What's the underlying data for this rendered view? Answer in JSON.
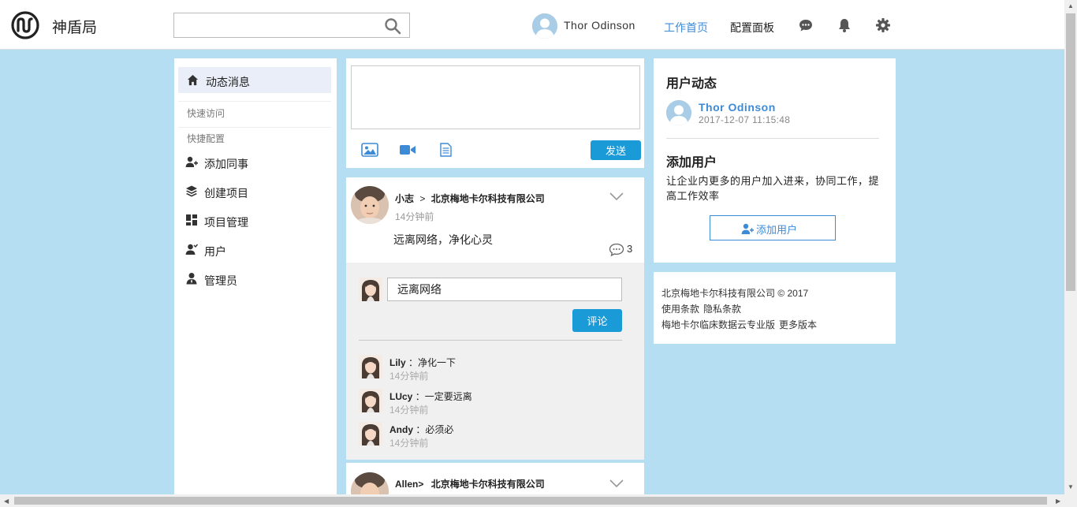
{
  "header": {
    "brand": "神盾局",
    "search_placeholder": "",
    "user_name": "Thor Odinson",
    "nav_home": "工作首页",
    "nav_panel": "配置面板",
    "accent_color": "#3d8ad6"
  },
  "sidebar": {
    "active_item": "动态消息",
    "section_quick_access": "快速访问",
    "section_quick_config": "快捷配置",
    "items": [
      {
        "label": "添加同事",
        "icon": "add-colleague-icon"
      },
      {
        "label": "创建项目",
        "icon": "layers-icon"
      },
      {
        "label": "项目管理",
        "icon": "dashboard-icon"
      },
      {
        "label": "用户",
        "icon": "user-icon"
      },
      {
        "label": "管理员",
        "icon": "admin-icon"
      }
    ]
  },
  "composer": {
    "send_label": "发送",
    "button_color": "#1a9ad6"
  },
  "post": {
    "author": "小志",
    "separator": ">",
    "company": "北京梅地卡尔科技有限公司",
    "time": "14分钟前",
    "content": "远离网络，净化心灵",
    "comment_count": "3",
    "comment_input_value": "远离网络",
    "comment_button": "评论",
    "comments": [
      {
        "name": "Lily",
        "sep": "：",
        "text": "净化一下",
        "time": "14分钟前"
      },
      {
        "name": "LUcy",
        "sep": "：",
        "text": "一定要远离",
        "time": "14分钟前"
      },
      {
        "name": "Andy",
        "sep": "：",
        "text": "必须必",
        "time": "14分钟前"
      }
    ]
  },
  "post2": {
    "author": "Allen>",
    "company": "北京梅地卡尔科技有限公司"
  },
  "activity": {
    "title": "用户动态",
    "user": "Thor Odinson",
    "time": "2017-12-07 11:15:48"
  },
  "add_user": {
    "title": "添加用户",
    "description": "让企业内更多的用户加入进来，协同工作，提高工作效率",
    "button": "添加用户"
  },
  "footer": {
    "copyright": "北京梅地卡尔科技有限公司 © 2017",
    "terms": "使用条款",
    "privacy": "隐私条款",
    "product": "梅地卡尔临床数据云专业版",
    "more_versions": "更多版本"
  }
}
